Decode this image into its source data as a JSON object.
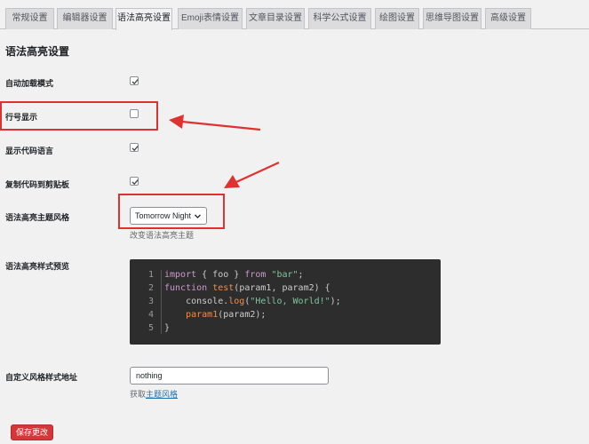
{
  "tabs": [
    {
      "label": "常规设置",
      "active": false
    },
    {
      "label": "编辑器设置",
      "active": false
    },
    {
      "label": "语法高亮设置",
      "active": true
    },
    {
      "label": "Emoji表情设置",
      "active": false
    },
    {
      "label": "文章目录设置",
      "active": false
    },
    {
      "label": "科学公式设置",
      "active": false
    },
    {
      "label": "绘图设置",
      "active": false
    },
    {
      "label": "思维导图设置",
      "active": false
    },
    {
      "label": "高级设置",
      "active": false
    }
  ],
  "section_title": "语法高亮设置",
  "settings": {
    "auto_load": {
      "label": "自动加载模式",
      "checked": true
    },
    "line_numbers": {
      "label": "行号显示",
      "checked": false
    },
    "show_language": {
      "label": "显示代码语言",
      "checked": true
    },
    "copy_code": {
      "label": "复制代码到剪贴板",
      "checked": true
    },
    "theme": {
      "label": "语法高亮主题风格",
      "value": "Tomorrow Night",
      "hint": "改变语法高亮主题"
    },
    "preview": {
      "label": "语法高亮样式预览"
    },
    "custom_url": {
      "label": "自定义风格样式地址",
      "value": "nothing",
      "hint_prefix": "获取",
      "hint_link": "主题风格"
    }
  },
  "code_preview": {
    "line_numbers": [
      "1",
      "2",
      "3",
      "4",
      "5"
    ],
    "lines": [
      [
        {
          "t": "kw",
          "v": "import"
        },
        {
          "t": "plain",
          "v": " { foo } "
        },
        {
          "t": "kw",
          "v": "from"
        },
        {
          "t": "plain",
          "v": " "
        },
        {
          "t": "str",
          "v": "\"bar\""
        },
        {
          "t": "plain",
          "v": ";"
        }
      ],
      [
        {
          "t": "kw",
          "v": "function"
        },
        {
          "t": "plain",
          "v": " "
        },
        {
          "t": "fn",
          "v": "test"
        },
        {
          "t": "plain",
          "v": "(param1, param2) {"
        }
      ],
      [
        {
          "t": "plain",
          "v": "    console."
        },
        {
          "t": "fn",
          "v": "log"
        },
        {
          "t": "plain",
          "v": "("
        },
        {
          "t": "str",
          "v": "\"Hello, World!\""
        },
        {
          "t": "plain",
          "v": ");"
        }
      ],
      [
        {
          "t": "plain",
          "v": "    "
        },
        {
          "t": "fn",
          "v": "param1"
        },
        {
          "t": "plain",
          "v": "(param2);"
        }
      ],
      [
        {
          "t": "plain",
          "v": "}"
        }
      ]
    ]
  },
  "save_button": "保存更改",
  "colors": {
    "annotation": "#e03131",
    "accent": "#2271b1",
    "save": "#d63638",
    "code_bg": "#2d2d2d"
  }
}
